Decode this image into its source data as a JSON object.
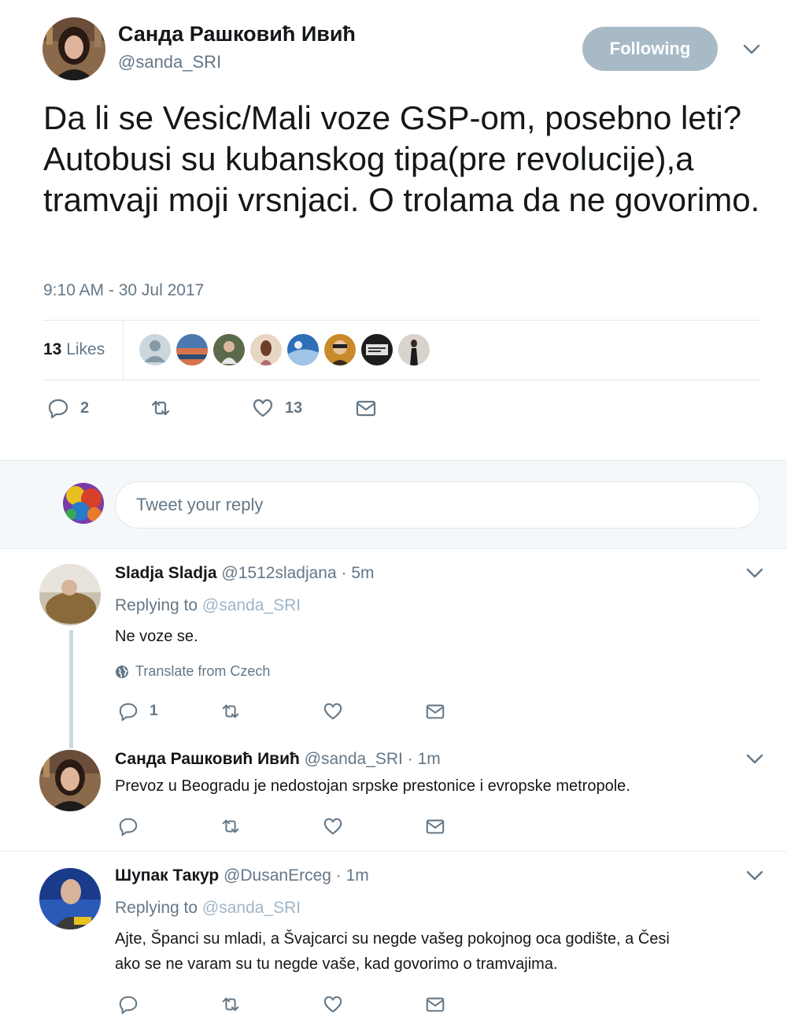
{
  "tweet": {
    "author_name": "Санда Рашковић Ивић",
    "author_handle": "@sanda_SRI",
    "follow_label": "Following",
    "text": "Da li se Vesic/Mali voze GSP-om, posebno leti?Autobusi su kubanskog tipa(pre revolucije),a tramvaji moji vrsnjaci. O trolama da ne govorimo.",
    "timestamp": "9:10 AM - 30 Jul 2017",
    "likes_number": "13",
    "likes_word": "Likes",
    "replies_count": "2",
    "like_count": "13"
  },
  "composer": {
    "placeholder": "Tweet your reply"
  },
  "replies": [
    {
      "name": "Sladja Sladja",
      "handle": "@1512sladjana",
      "time": "· 5m",
      "replying_prefix": "Replying to",
      "replying_handle": "@sanda_SRI",
      "text": "Ne voze se.",
      "translate": "Translate from Czech",
      "reply_count": "1"
    },
    {
      "name": "Санда Рашковић Ивић",
      "handle": "@sanda_SRI",
      "time": "· 1m",
      "text": "Prevoz u Beogradu je nedostojan srpske prestonice i evropske metropole."
    },
    {
      "name": "Шупак Такур",
      "handle": "@DusanErceg",
      "time": "· 1m",
      "replying_prefix": "Replying to",
      "replying_handle": "@sanda_SRI",
      "text_line1": "Ajte, Španci su mladi, a Švajcarci su negde vašeg pokojnog oca godište, a Česi",
      "text_line2": "ako se ne varam su tu negde vaše, kad govorimo o tramvajima."
    }
  ],
  "icons": {
    "reply": "reply-icon",
    "retweet": "retweet-icon",
    "like": "heart-icon",
    "message": "envelope-icon",
    "more": "chevron-down-icon",
    "translate": "globe-icon"
  },
  "colors": {
    "follow_button": "#a9bac7",
    "secondary_text": "#657786",
    "link_faded": "#9fb6c8",
    "composer_bg": "#f5f8fa"
  }
}
